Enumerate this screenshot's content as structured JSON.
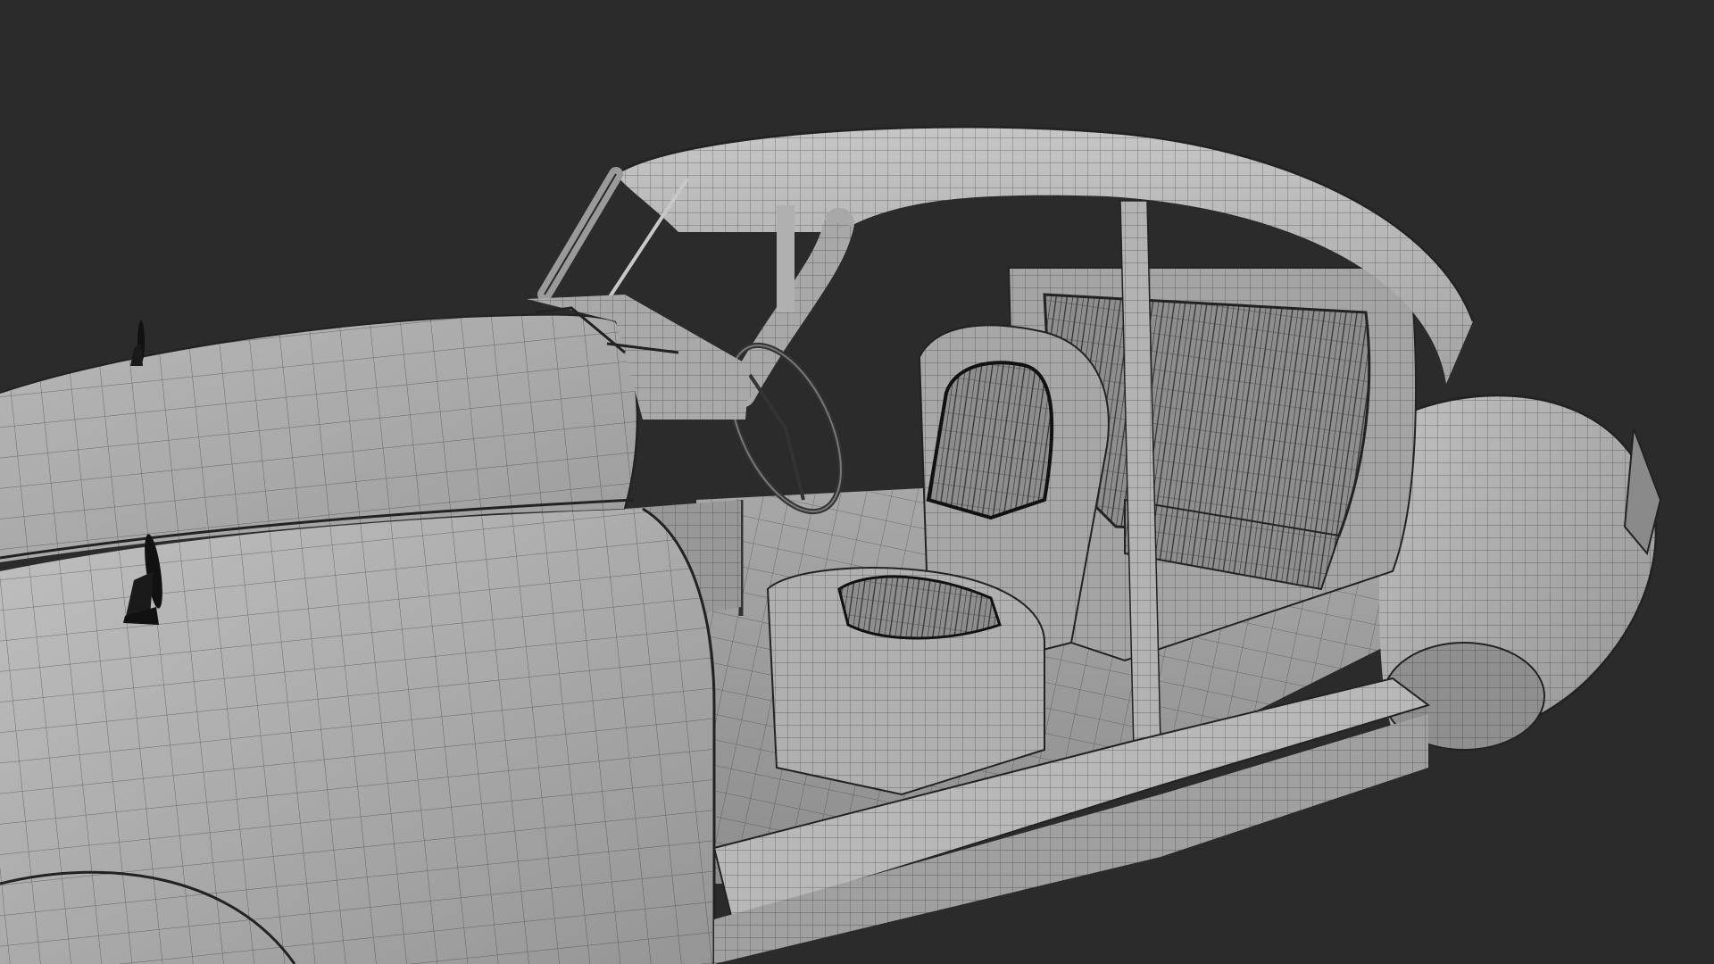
{
  "viewport": {
    "background_color": "#2b2b2b",
    "render_style": "wireframe-on-shaded",
    "subject": "car-model"
  },
  "palette": {
    "surface_light": "#b9b9b9",
    "surface_mid": "#9f9f9f",
    "surface_dark": "#7d7d7d",
    "wire": "#2e2e2e",
    "ink": "#111111"
  },
  "icons": [
    "wing-mirror-icon",
    "steering-wheel-icon",
    "windshield-wiper-icon"
  ]
}
